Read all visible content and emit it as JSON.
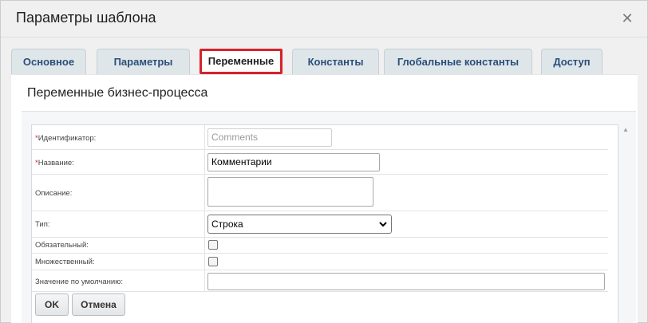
{
  "dialog": {
    "title": "Параметры шаблона",
    "close_icon": "close-icon"
  },
  "tabs": [
    {
      "label": "Основное",
      "active": false
    },
    {
      "label": "Параметры",
      "active": false
    },
    {
      "label": "Переменные",
      "active": true
    },
    {
      "label": "Константы",
      "active": false
    },
    {
      "label": "Глобальные константы",
      "active": false
    },
    {
      "label": "Доступ",
      "active": false
    }
  ],
  "panel": {
    "heading": "Переменные бизнес-процесса"
  },
  "form": {
    "identifier": {
      "required_mark": "*",
      "label": "Идентификатор:",
      "placeholder": "Comments",
      "value": ""
    },
    "name": {
      "required_mark": "*",
      "label": "Название:",
      "value": "Комментарии"
    },
    "description": {
      "label": "Описание:",
      "value": ""
    },
    "type": {
      "label": "Тип:",
      "selected": "Строка"
    },
    "required": {
      "label": "Обязательный:",
      "checked": false
    },
    "multiple": {
      "label": "Множественный:",
      "checked": false
    },
    "default": {
      "label": "Значение по умолчанию:",
      "value": ""
    }
  },
  "buttons": {
    "ok": "OK",
    "cancel": "Отмена"
  },
  "colors": {
    "active_tab_outline": "#d6232a",
    "tab_text": "#2a4f78"
  }
}
